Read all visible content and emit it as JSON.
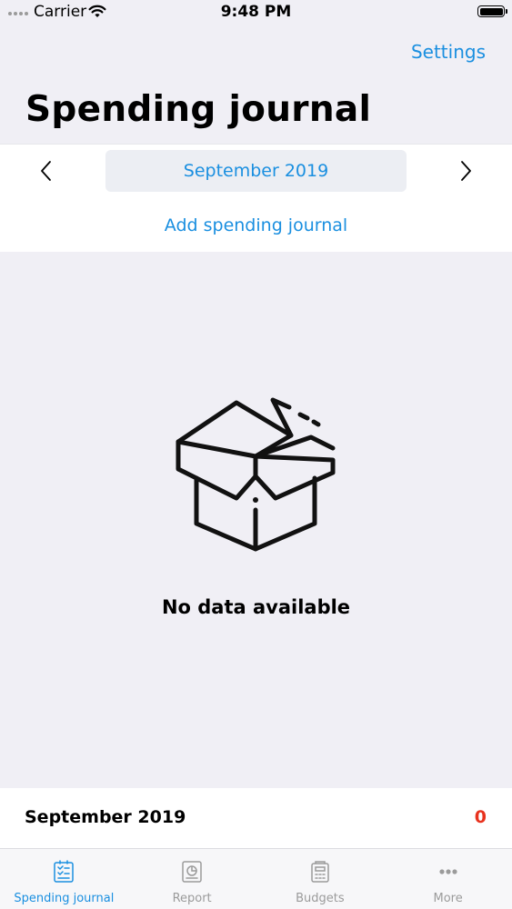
{
  "status_bar": {
    "carrier": "Carrier",
    "time": "9:48 PM"
  },
  "header": {
    "settings_label": "Settings",
    "title": "Spending journal"
  },
  "month_nav": {
    "prev_icon": "chevron-left-icon",
    "current_month": "September 2019",
    "next_icon": "chevron-right-icon"
  },
  "add_action": {
    "label": "Add spending journal"
  },
  "empty_state": {
    "icon": "empty-box-icon",
    "message": "No data available"
  },
  "summary": {
    "month": "September 2019",
    "total": "0"
  },
  "tab_bar": {
    "tabs": [
      {
        "label": "Spending journal",
        "icon": "journal-icon",
        "active": true
      },
      {
        "label": "Report",
        "icon": "report-icon",
        "active": false
      },
      {
        "label": "Budgets",
        "icon": "budgets-icon",
        "active": false
      },
      {
        "label": "More",
        "icon": "more-icon",
        "active": false
      }
    ]
  },
  "colors": {
    "accent": "#1a8fe0",
    "total_red": "#e8321e",
    "background": "#f0eff5"
  }
}
